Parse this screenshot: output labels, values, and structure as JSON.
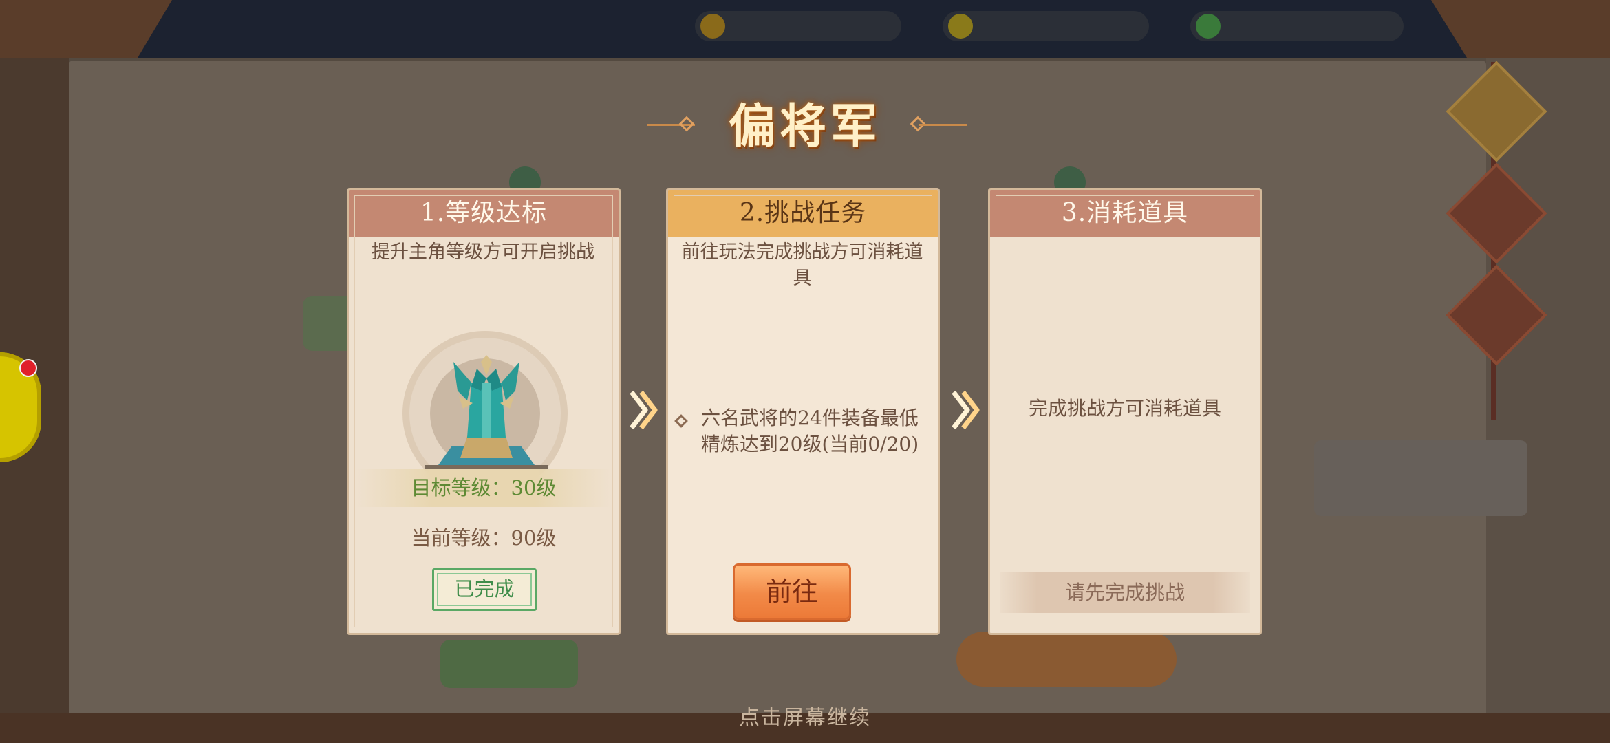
{
  "modal": {
    "title": "偏将军",
    "continue_hint": "点击屏幕继续"
  },
  "steps": [
    {
      "header": "1.等级达标",
      "description": "提升主角等级方可开启挑战",
      "target_level": "目标等级：30级",
      "current_level": "当前等级：90级",
      "status_badge": "已完成"
    },
    {
      "header": "2.挑战任务",
      "description": "前往玩法完成挑战方可消耗道具",
      "requirement": "六名武将的24件装备最低精炼达到20级(当前0/20)",
      "go_button": "前往"
    },
    {
      "header": "3.消耗道具",
      "center_text": "完成挑战方可消耗道具",
      "locked_button": "请先完成挑战"
    }
  ],
  "icons": {
    "emblem": "general-helmet-emblem-icon",
    "arrow": "double-chevron-right-icon",
    "requirement_bullet": "diamond-bullet-icon"
  },
  "colors": {
    "header_active": "#eab15f",
    "header_inactive": "#c48872",
    "done_green": "#3f8d4a",
    "go_orange": "#f28a48",
    "title_glow": "#b86a22"
  }
}
